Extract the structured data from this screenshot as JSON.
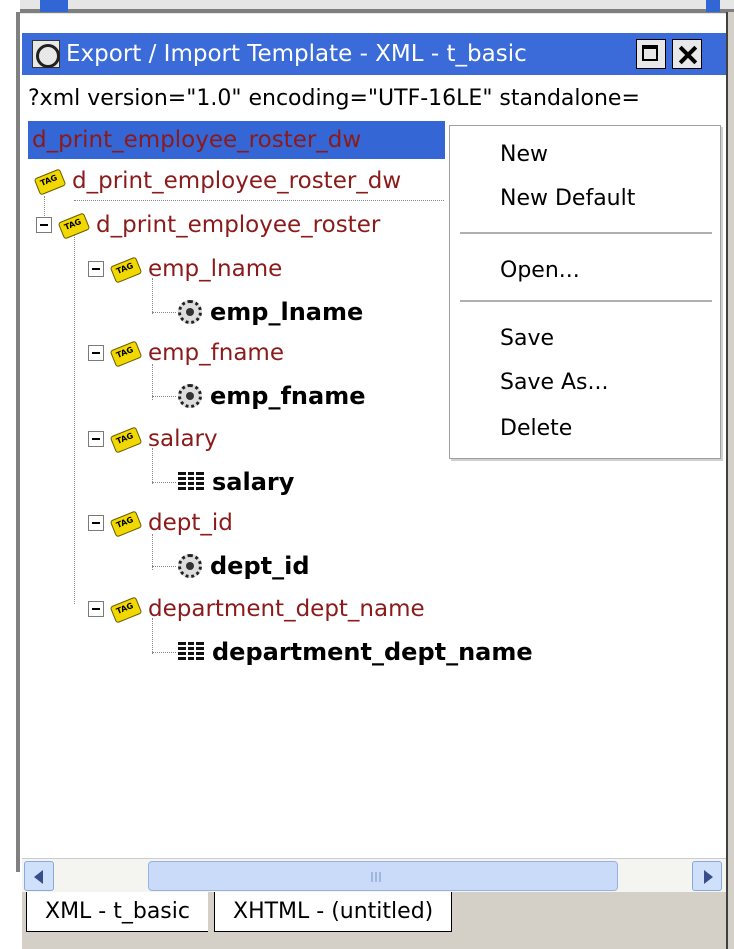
{
  "window": {
    "title": "Export / Import Template - XML - t_basic"
  },
  "xml_declaration": "?xml version=\"1.0\" encoding=\"UTF-16LE\" standalone=",
  "tree": {
    "selected_root": "d_print_employee_roster_dw",
    "child_root": "d_print_employee_roster_dw",
    "element": "d_print_employee_roster",
    "items": [
      {
        "tag": "emp_lname",
        "column": "emp_lname",
        "column_icon": "gear-icon"
      },
      {
        "tag": "emp_fname",
        "column": "emp_fname",
        "column_icon": "gear-icon"
      },
      {
        "tag": "salary",
        "column": "salary",
        "column_icon": "table-icon"
      },
      {
        "tag": "dept_id",
        "column": "dept_id",
        "column_icon": "gear-icon"
      },
      {
        "tag": "department_dept_name",
        "column": "department_dept_name",
        "column_icon": "table-icon"
      }
    ]
  },
  "context_menu": {
    "new": "New",
    "new_default": "New Default",
    "open": "Open...",
    "save": "Save",
    "save_as": "Save As...",
    "delete": "Delete"
  },
  "tabs": [
    {
      "label": "XML - t_basic",
      "active": true
    },
    {
      "label": "XHTML - (untitled)",
      "active": false
    }
  ],
  "colors": {
    "title_bar": "#3a6bd9",
    "selection": "#3466d6",
    "tag_text": "#8b1a1a"
  }
}
